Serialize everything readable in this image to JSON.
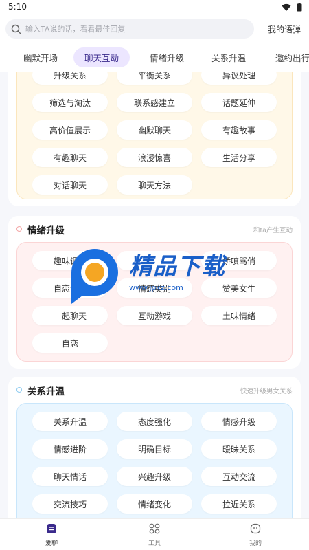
{
  "status": {
    "time": "5:10"
  },
  "search": {
    "placeholder": "输入TA说的话，看看最佳回复",
    "my_phrases": "我的语弹"
  },
  "tabs": [
    "幽默开场",
    "聊天互动",
    "情绪升级",
    "关系升温",
    "邀约出行"
  ],
  "sections": [
    {
      "title": "",
      "subtitle": "",
      "partial_row": [
        "升级关系",
        "平衡关系",
        "异议处理"
      ],
      "chips": [
        "筛选与淘汰",
        "联系感建立",
        "话题延伸",
        "高价值展示",
        "幽默聊天",
        "有趣故事",
        "有趣聊天",
        "浪漫惊喜",
        "生活分享",
        "对话聊天",
        "聊天方法"
      ]
    },
    {
      "title": "情绪升级",
      "subtitle": "和ta产生互动",
      "chips": [
        "趣味调侃",
        "",
        "娇嗔骂俏",
        "自恋调侃",
        "情感类别",
        "赞美女生",
        "一起聊天",
        "互动游戏",
        "土味情绪",
        "自恋"
      ]
    },
    {
      "title": "关系升温",
      "subtitle": "快速升级男女关系",
      "chips": [
        "关系升温",
        "态度强化",
        "情感升级",
        "情感进阶",
        "明确目标",
        "暧昧关系",
        "聊天情话",
        "兴趣升级",
        "互动交流",
        "交流技巧",
        "情绪变化",
        "拉近关系"
      ]
    }
  ],
  "watermark": {
    "text": "精品下载",
    "url": "www.jpxz.com"
  },
  "bottom_nav": [
    "爱聊",
    "工具",
    "我的"
  ],
  "colors": {
    "accent": "#6a4cf5",
    "panel_yellow": "#fff8e8",
    "panel_pink": "#fff1f1",
    "panel_blue": "#eaf6ff"
  }
}
